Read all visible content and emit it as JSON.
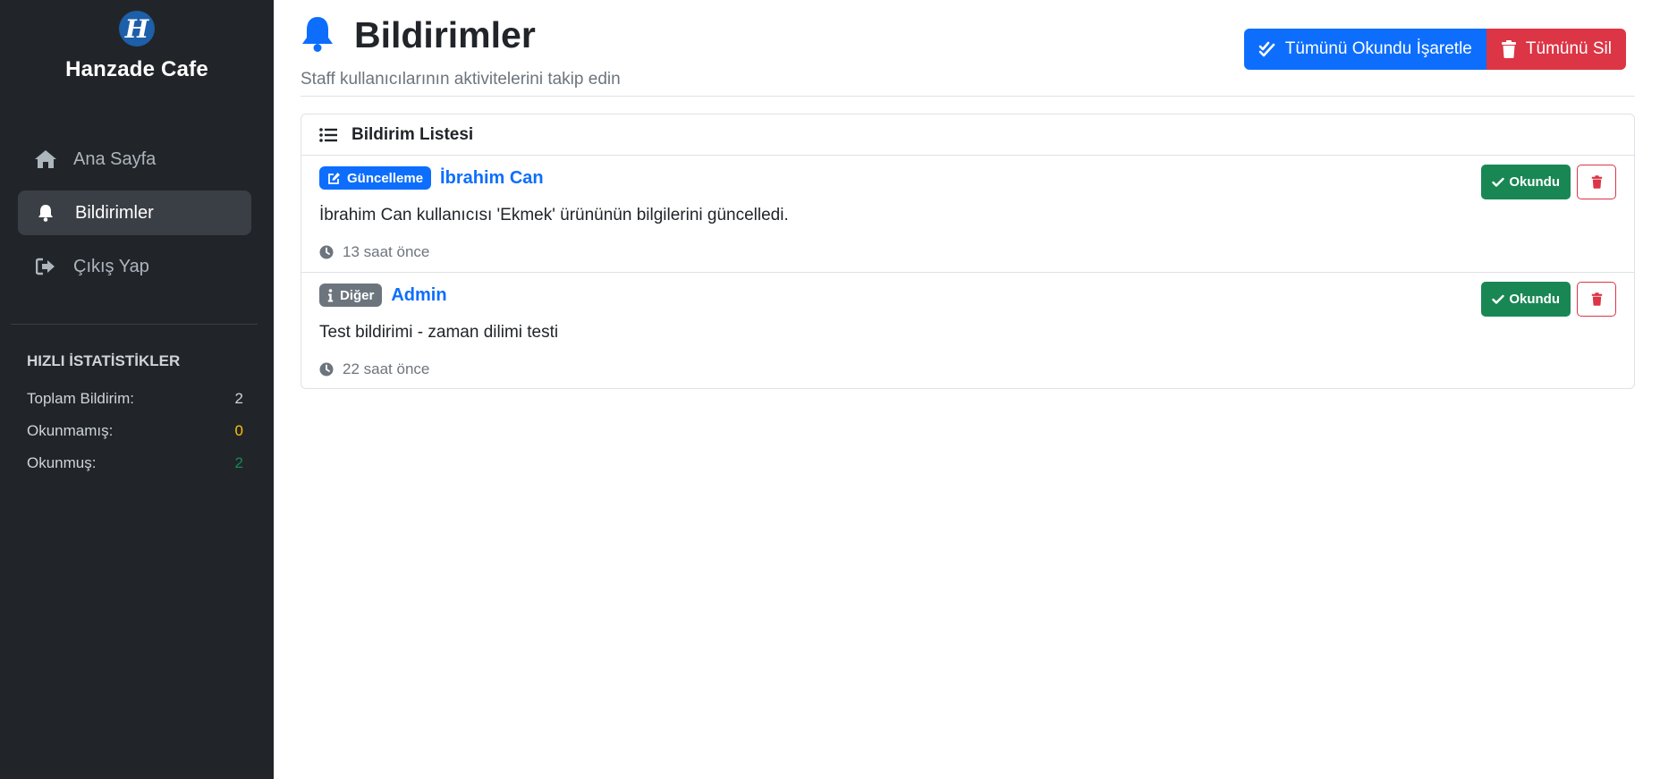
{
  "brand": {
    "logo_letter": "H",
    "name": "Hanzade Cafe"
  },
  "nav": {
    "items": [
      {
        "label": "Ana Sayfa",
        "icon": "home-icon"
      },
      {
        "label": "Bildirimler",
        "icon": "bell-icon",
        "active": true
      },
      {
        "label": "Çıkış Yap",
        "icon": "sign-out-icon"
      }
    ]
  },
  "stats": {
    "title": "HIZLI İSTATİSTİKLER",
    "rows": [
      {
        "label": "Toplam Bildirim:",
        "value": "2"
      },
      {
        "label": "Okunmamış:",
        "value": "0"
      },
      {
        "label": "Okunmuş:",
        "value": "2"
      }
    ]
  },
  "header": {
    "title": "Bildirimler",
    "subtitle": "Staff kullanıcılarının aktivitelerini takip edin",
    "mark_all_label": "Tümünü Okundu İşaretle",
    "delete_all_label": "Tümünü Sil"
  },
  "card": {
    "title": "Bildirim Listesi",
    "notifications": [
      {
        "badge": "Güncelleme",
        "badge_icon": "edit-icon",
        "user": "İbrahim Can",
        "message": "İbrahim Can kullanıcısı 'Ekmek' ürününün bilgilerini güncelledi.",
        "time": "13 saat önce",
        "read_label": "Okundu"
      },
      {
        "badge": "Diğer",
        "badge_icon": "info-icon",
        "user": "Admin",
        "message": "Test bildirimi - zaman dilimi testi",
        "time": "22 saat önce",
        "read_label": "Okundu"
      }
    ]
  },
  "colors": {
    "sidebar_bg": "#212529",
    "primary": "#0d6efd",
    "danger": "#dc3545",
    "success": "#198754",
    "warning": "#ffc107",
    "secondary": "#6c757d"
  }
}
